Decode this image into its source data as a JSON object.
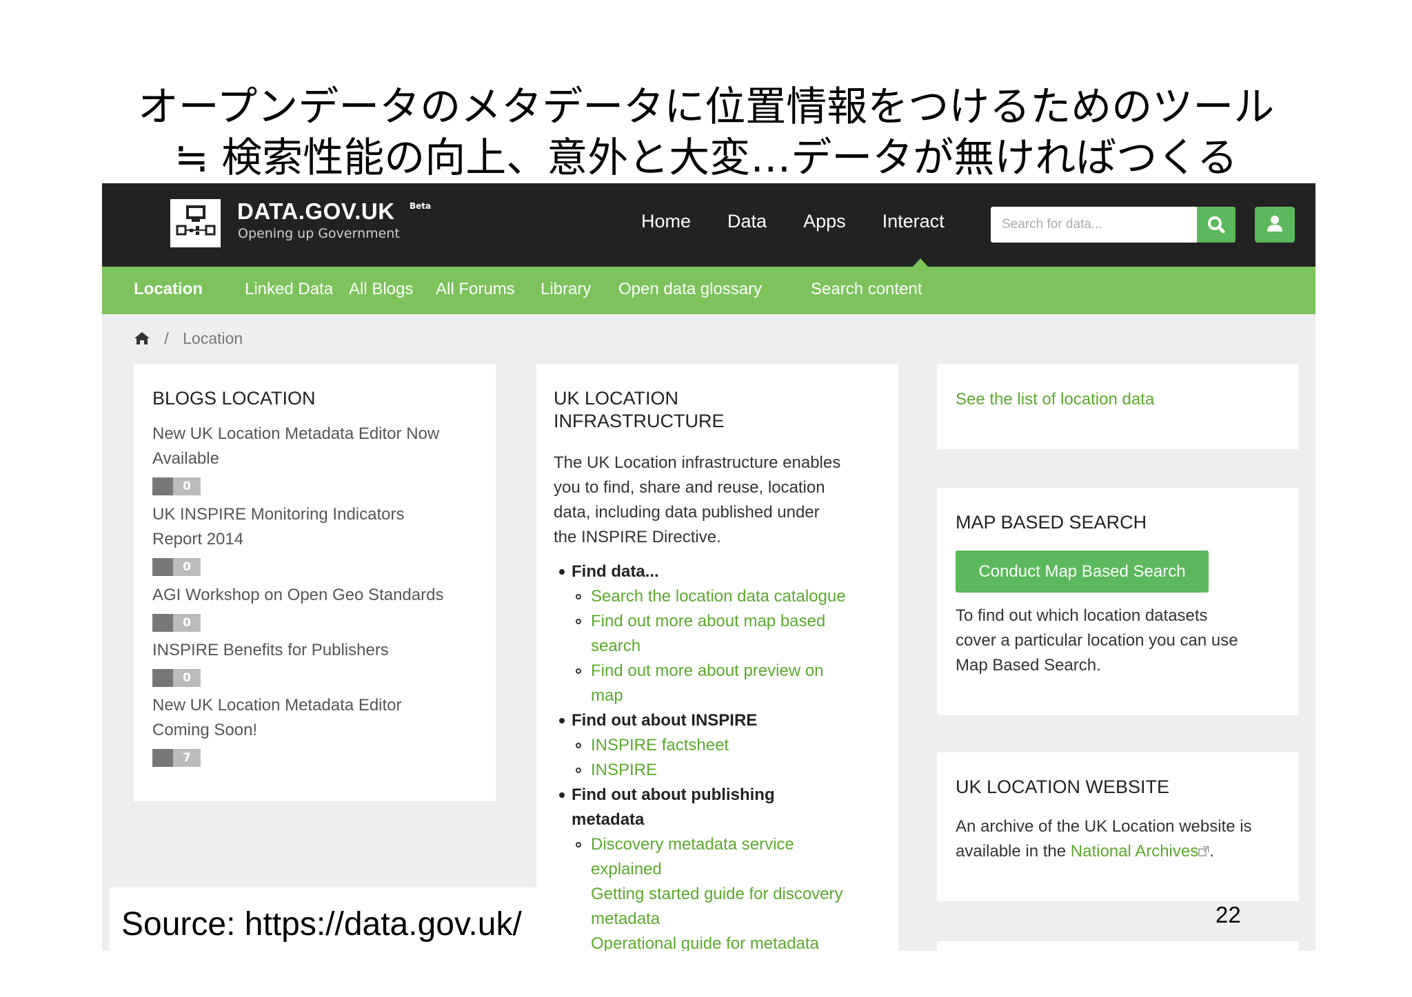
{
  "slide": {
    "title_line1": "オープンデータのメタデータに位置情報をつけるためのツール",
    "title_line2": "≒ 検索性能の向上、意外と大変…データが無ければつくる",
    "source": "Source: https://data.gov.uk/",
    "page_number": "22"
  },
  "header": {
    "site_name": "DATA.GOV.UK",
    "beta": "Beta",
    "tagline": "Opening up Government",
    "nav": [
      "Home",
      "Data",
      "Apps",
      "Interact"
    ],
    "search_placeholder": "Search for data...",
    "icons": {
      "search": "search-icon",
      "user": "user-icon"
    }
  },
  "subnav": {
    "items": [
      "Location",
      "Linked Data",
      "All Blogs",
      "All Forums",
      "Library",
      "Open data glossary",
      "Search content"
    ],
    "active": "Location"
  },
  "breadcrumb": {
    "home_icon": "home-icon",
    "separator": "/",
    "current": "Location"
  },
  "blogs": {
    "title": "BLOGS LOCATION",
    "items": [
      {
        "l1": "New UK Location Metadata Editor Now",
        "l2": "Available",
        "count": "0"
      },
      {
        "l1": "UK INSPIRE Monitoring Indicators",
        "l2": "Report 2014",
        "count": "0"
      },
      {
        "l1": "AGI Workshop on Open Geo Standards",
        "l2": "",
        "count": "0"
      },
      {
        "l1": "INSPIRE Benefits for Publishers",
        "l2": "",
        "count": "0"
      },
      {
        "l1": "New UK Location Metadata Editor",
        "l2": "Coming Soon!",
        "count": "7"
      }
    ]
  },
  "infra": {
    "title1": "UK LOCATION",
    "title2": "INFRASTRUCTURE",
    "intro": [
      "The UK Location infrastructure enables",
      "you to find, share and reuse, location",
      "data, including data published under",
      "the INSPIRE Directive."
    ],
    "find_data": "Find data...",
    "find_data_links": [
      "Search the location data catalogue",
      "Find out more about map based",
      "search",
      "Find out more about preview on",
      "map"
    ],
    "find_inspire": "Find out about INSPIRE",
    "inspire_links": [
      "INSPIRE factsheet",
      "INSPIRE"
    ],
    "find_publishing1": "Find out about publishing",
    "find_publishing2": "metadata",
    "publishing_links": [
      "Discovery metadata service",
      "explained",
      "Getting started guide for discovery",
      "metadata",
      "Operational guide for metadata"
    ]
  },
  "right": {
    "list_link": "See the list of location data",
    "map_title": "MAP BASED SEARCH",
    "map_button": "Conduct Map Based Search",
    "map_text": [
      "To find out which location datasets",
      "cover a particular location you can use",
      "Map Based Search."
    ],
    "website_title": "UK LOCATION WEBSITE",
    "website_text1": "An archive of the UK Location website is",
    "website_text2": "available in the",
    "website_link": "National Archives",
    "website_end": "."
  },
  "colors": {
    "accent_green": "#7dc25b",
    "link_green": "#5aa92b",
    "button_green": "#5cb85c",
    "header_dark": "#222222"
  }
}
